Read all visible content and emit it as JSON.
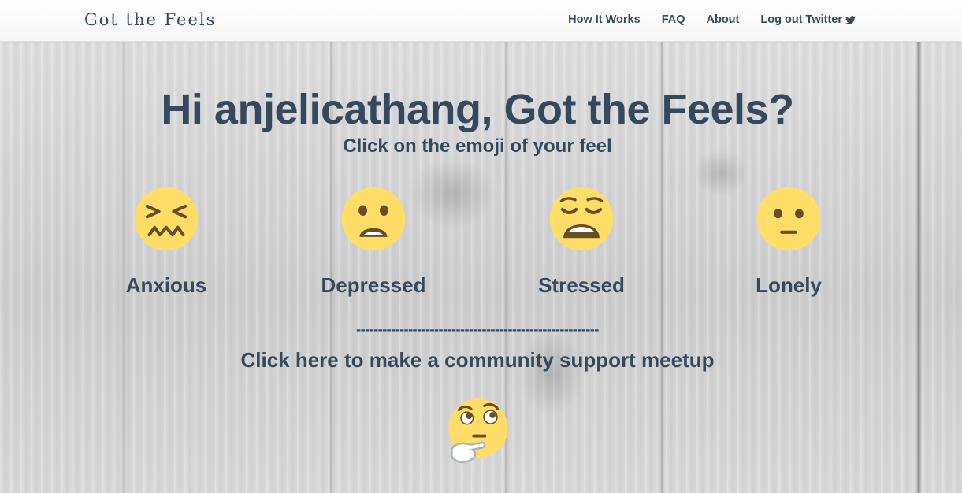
{
  "navbar": {
    "brand": "Got the Feels",
    "links": [
      {
        "label": "How It Works"
      },
      {
        "label": "FAQ"
      },
      {
        "label": "About"
      },
      {
        "label": "Log out Twitter",
        "icon": "twitter-icon"
      }
    ]
  },
  "hero": {
    "title": "Hi anjelicathang, Got the Feels?",
    "subtitle": "Click on the emoji of your feel"
  },
  "feels": [
    {
      "label": "Anxious",
      "icon": "confounded-face-icon"
    },
    {
      "label": "Depressed",
      "icon": "anguished-face-icon"
    },
    {
      "label": "Stressed",
      "icon": "weary-face-icon"
    },
    {
      "label": "Lonely",
      "icon": "neutral-face-icon"
    }
  ],
  "divider": "--------------------------------------------------------",
  "meetup": {
    "label": "Click here to make a community support meetup",
    "icon": "thinking-face-icon"
  },
  "colors": {
    "text": "#34495e",
    "emoji_yellow": "#ffdd67",
    "emoji_feature": "#664e27",
    "navbar_bg": "#ffffff"
  }
}
